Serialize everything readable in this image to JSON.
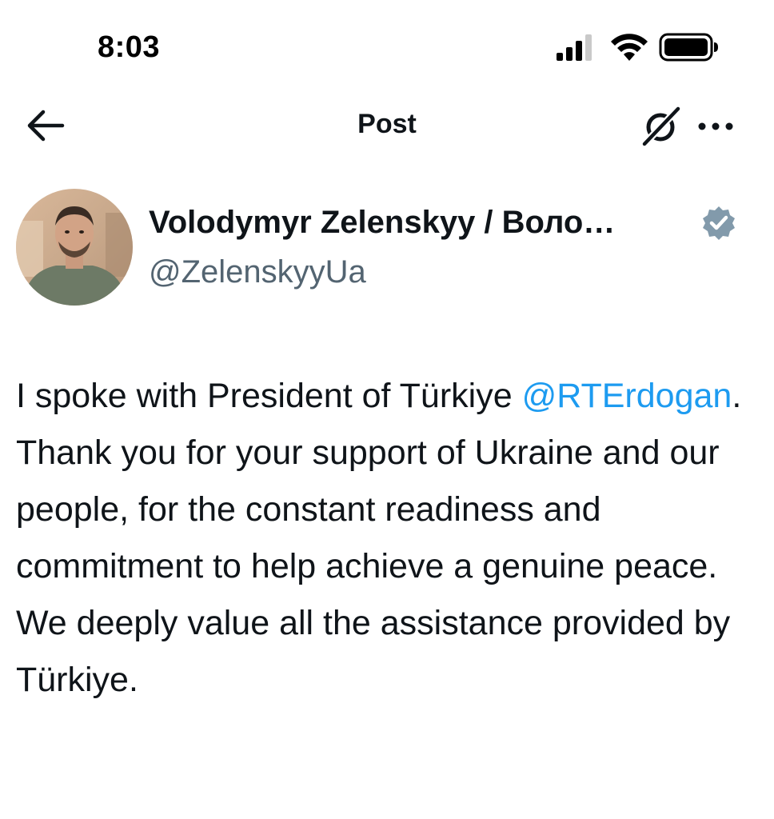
{
  "status_bar": {
    "time": "8:03",
    "icons": [
      "cellular-signal-icon",
      "wifi-icon",
      "battery-icon"
    ]
  },
  "nav": {
    "back_icon": "arrow-left-icon",
    "title": "Post",
    "grok_icon": "grok-icon",
    "more_icon": "more-horizontal-icon"
  },
  "author": {
    "display_name": "Volodymyr Zelenskyy / Воло…",
    "handle": "@ZelenskyyUa",
    "verified": true,
    "verified_icon": "verified-badge-icon"
  },
  "post": {
    "text_before_mention": "I spoke with President of Türkiye ",
    "mention": "@RTErdogan",
    "text_after_mention": ". Thank you for your support of Ukraine and our people, for the constant readiness and commitment to help achieve a genuine peace. We deeply value all the assistance provided by Türkiye."
  },
  "colors": {
    "text": "#0f1419",
    "secondary_text": "#536471",
    "link": "#1d9bf0",
    "verified_badge": "#829aab",
    "background": "#ffffff"
  }
}
